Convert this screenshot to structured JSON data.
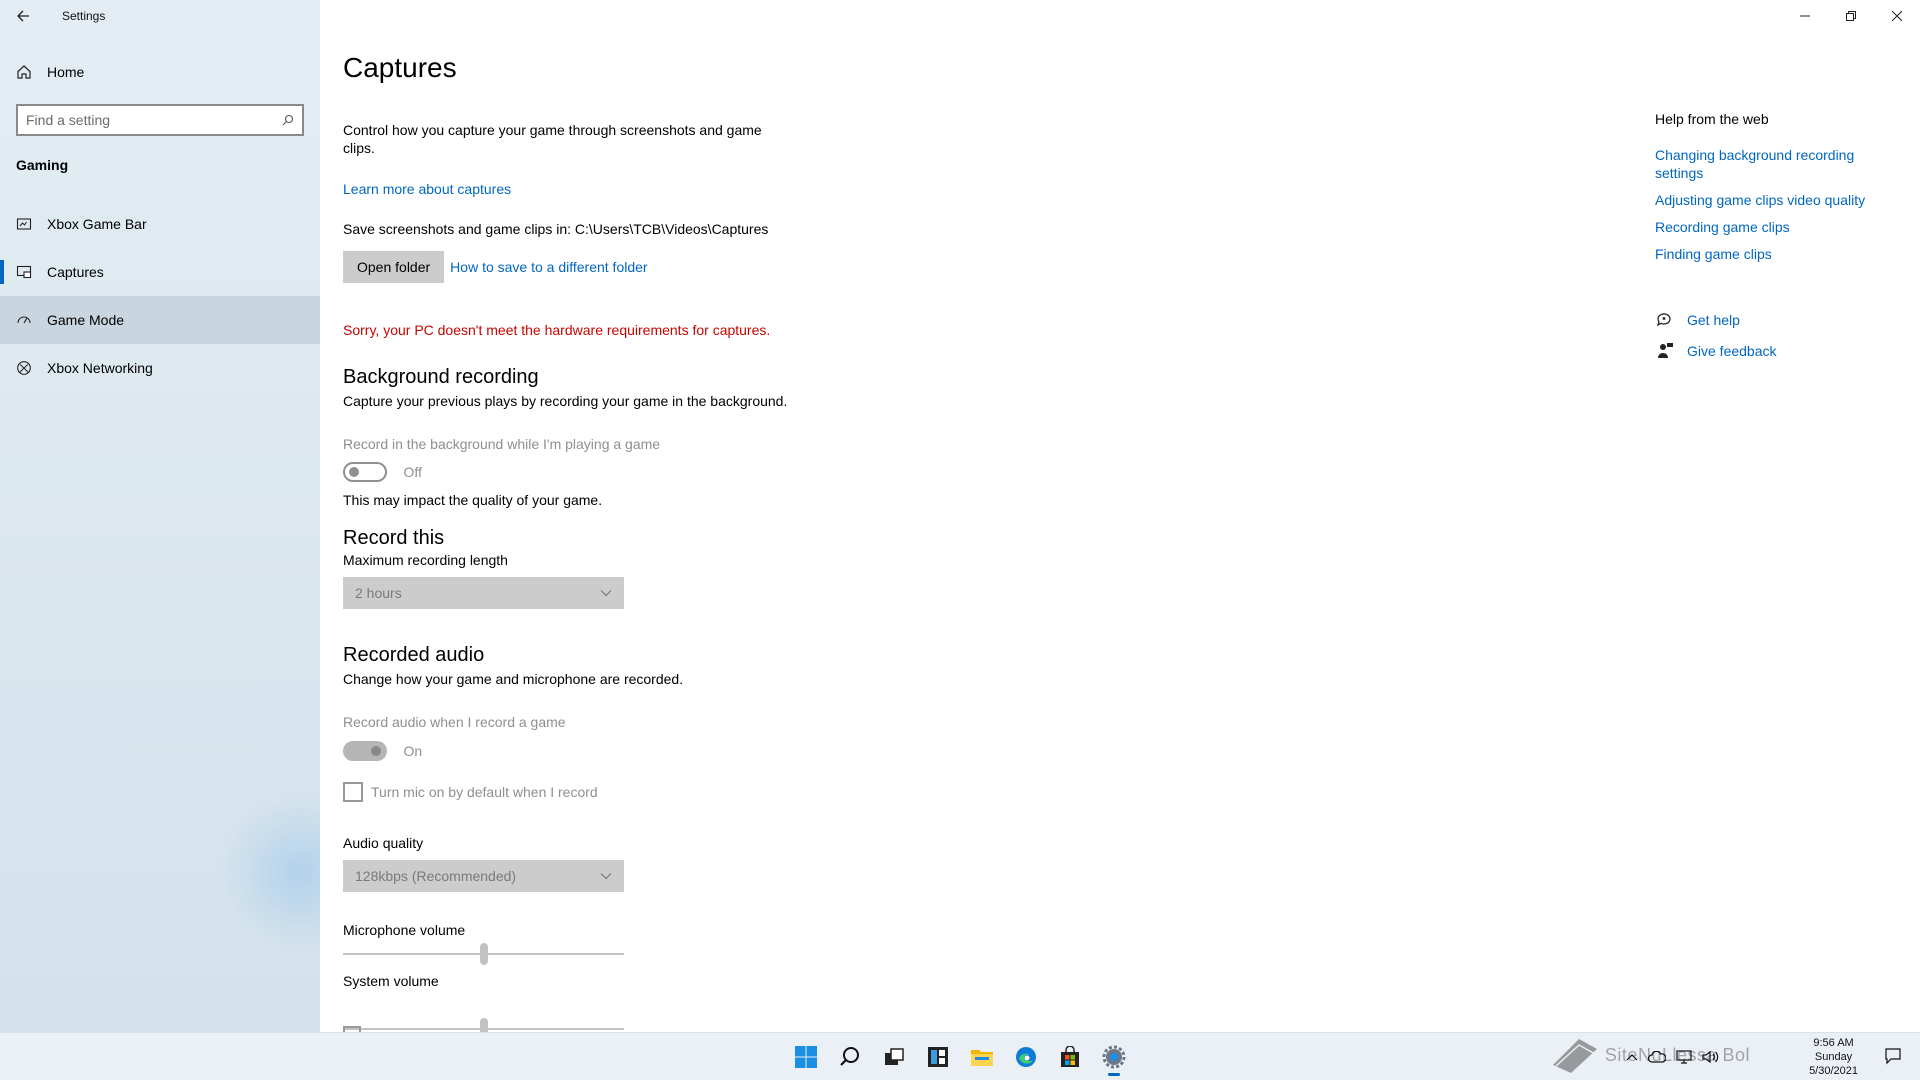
{
  "window": {
    "app_title": "Settings",
    "back_icon": "back-arrow-icon",
    "controls": [
      "minimize-icon",
      "restore-icon",
      "close-icon"
    ]
  },
  "sidebar": {
    "home_label": "Home",
    "search_placeholder": "Find a setting",
    "section_title": "Gaming",
    "items": [
      {
        "label": "Xbox Game Bar",
        "icon": "game-bar-icon"
      },
      {
        "label": "Captures",
        "icon": "captures-icon",
        "selected": true
      },
      {
        "label": "Game Mode",
        "icon": "game-mode-icon",
        "hover": true
      },
      {
        "label": "Xbox Networking",
        "icon": "xbox-icon"
      }
    ]
  },
  "main": {
    "title": "Captures",
    "description": "Control how you capture your game through screenshots and game clips.",
    "learn_more": "Learn more about captures",
    "save_path_text": "Save screenshots and game clips in: C:\\Users\\TCB\\Videos\\Captures",
    "open_folder_button": "Open folder",
    "different_folder_link": "How to save to a different folder",
    "error_text": "Sorry, your PC doesn't meet the hardware requirements for captures.",
    "background_recording": {
      "heading": "Background recording",
      "description": "Capture your previous plays by recording your game in the background.",
      "toggle_label": "Record in the background while I'm playing a game",
      "toggle_state": "Off",
      "note": "This may impact the quality of your game."
    },
    "record_this": {
      "heading": "Record this",
      "max_length_label": "Maximum recording length",
      "max_length_value": "2 hours"
    },
    "recorded_audio": {
      "heading": "Recorded audio",
      "description": "Change how your game and microphone are recorded.",
      "toggle_label": "Record audio when I record a game",
      "toggle_state": "On",
      "mic_checkbox_label": "Turn mic on by default when I record",
      "audio_quality_label": "Audio quality",
      "audio_quality_value": "128kbps (Recommended)",
      "mic_volume_label": "Microphone volume",
      "mic_volume_level": 0.5,
      "system_volume_label": "System volume",
      "system_volume_level": 0.5
    }
  },
  "help": {
    "title": "Help from the web",
    "links": [
      "Changing background recording settings",
      "Adjusting game clips video quality",
      "Recording game clips",
      "Finding game clips"
    ],
    "get_help": "Get help",
    "give_feedback": "Give feedback"
  },
  "taskbar": {
    "icons": [
      "start-icon",
      "search-icon",
      "task-view-icon",
      "widgets-icon",
      "file-explorer-icon",
      "edge-icon",
      "store-icon",
      "settings-icon"
    ],
    "time": "9:56 AM",
    "day": "Sunday",
    "date": "5/30/2021",
    "watermark_text": "SiteNuLlessa Bol",
    "accent": "#0067c0"
  }
}
